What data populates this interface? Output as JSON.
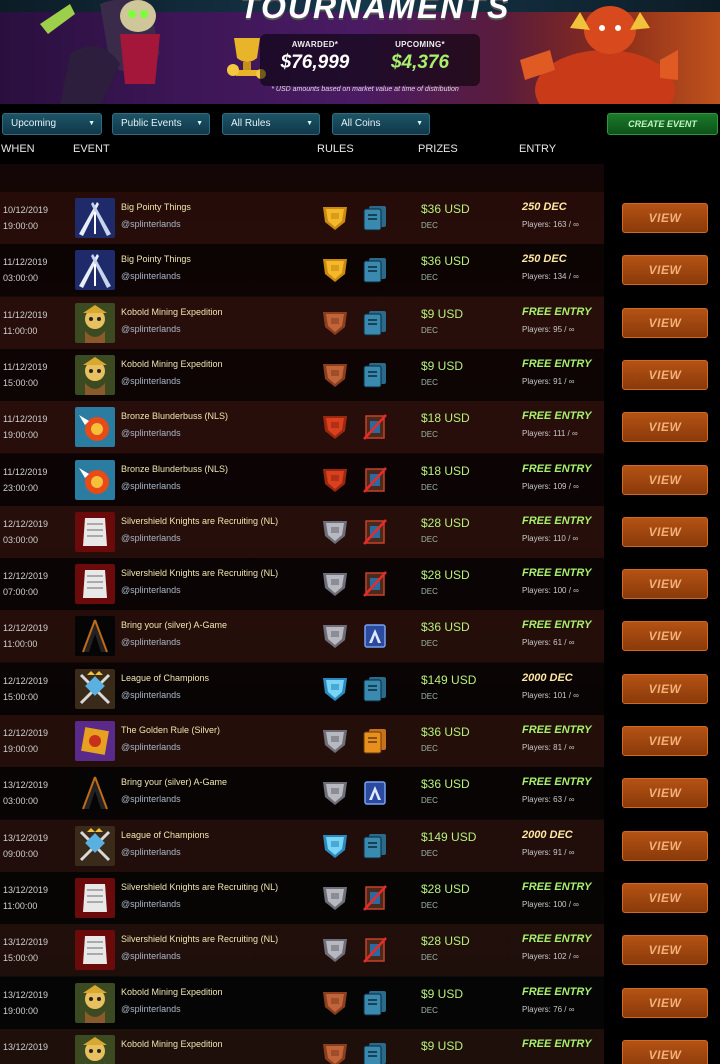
{
  "banner": {
    "title": "TOURNAMENTS",
    "awarded_label": "AWARDED*",
    "awarded_value": "$76,999",
    "upcoming_label": "UPCOMING*",
    "upcoming_value": "$4,376",
    "note": "* USD amounts based on market value at time of distribution"
  },
  "filters": {
    "status": "Upcoming",
    "visibility": "Public Events",
    "rules": "All Rules",
    "coins": "All Coins",
    "create_label": "CREATE EVENT"
  },
  "columns": {
    "when": "WHEN",
    "event": "EVENT",
    "rules": "RULES",
    "prizes": "PRIZES",
    "entry": "ENTRY"
  },
  "view_label": "VIEW",
  "events": [
    {
      "date": "10/12/2019",
      "time": "19:00:00",
      "name": "Big Pointy Things",
      "org": "@splinterlands",
      "thumb": "pointy",
      "rule1": "gold",
      "rule2": "blue",
      "prize": "$36 USD",
      "prize_sub": "DEC",
      "entry": "250 DEC",
      "free": false,
      "players": "Players: 163 / ∞"
    },
    {
      "date": "11/12/2019",
      "time": "03:00:00",
      "name": "Big Pointy Things",
      "org": "@splinterlands",
      "thumb": "pointy",
      "rule1": "gold",
      "rule2": "blue",
      "prize": "$36 USD",
      "prize_sub": "DEC",
      "entry": "250 DEC",
      "free": false,
      "players": "Players: 134 / ∞"
    },
    {
      "date": "11/12/2019",
      "time": "11:00:00",
      "name": "Kobold Mining Expedition",
      "org": "@splinterlands",
      "thumb": "kobold",
      "rule1": "bronze",
      "rule2": "blue",
      "prize": "$9 USD",
      "prize_sub": "DEC",
      "entry": "FREE ENTRY",
      "free": true,
      "players": "Players: 95 / ∞"
    },
    {
      "date": "11/12/2019",
      "time": "15:00:00",
      "name": "Kobold Mining Expedition",
      "org": "@splinterlands",
      "thumb": "kobold",
      "rule1": "bronze",
      "rule2": "blue",
      "prize": "$9 USD",
      "prize_sub": "DEC",
      "entry": "FREE ENTRY",
      "free": true,
      "players": "Players: 91 / ∞"
    },
    {
      "date": "11/12/2019",
      "time": "19:00:00",
      "name": "Bronze Blunderbuss (NLS)",
      "org": "@splinterlands",
      "thumb": "blunder",
      "rule1": "red",
      "rule2": "nolegend",
      "prize": "$18 USD",
      "prize_sub": "DEC",
      "entry": "FREE ENTRY",
      "free": true,
      "players": "Players: 111 / ∞"
    },
    {
      "date": "11/12/2019",
      "time": "23:00:00",
      "name": "Bronze Blunderbuss (NLS)",
      "org": "@splinterlands",
      "thumb": "blunder",
      "rule1": "red",
      "rule2": "nolegend",
      "prize": "$18 USD",
      "prize_sub": "DEC",
      "entry": "FREE ENTRY",
      "free": true,
      "players": "Players: 109 / ∞"
    },
    {
      "date": "12/12/2019",
      "time": "03:00:00",
      "name": "Silvershield Knights are Recruiting (NL)",
      "org": "@splinterlands",
      "thumb": "silver",
      "rule1": "silver",
      "rule2": "nolegend",
      "prize": "$28 USD",
      "prize_sub": "DEC",
      "entry": "FREE ENTRY",
      "free": true,
      "players": "Players: 110 / ∞"
    },
    {
      "date": "12/12/2019",
      "time": "07:00:00",
      "name": "Silvershield Knights are Recruiting (NL)",
      "org": "@splinterlands",
      "thumb": "silver",
      "rule1": "silver",
      "rule2": "nolegend",
      "prize": "$28 USD",
      "prize_sub": "DEC",
      "entry": "FREE ENTRY",
      "free": true,
      "players": "Players: 100 / ∞"
    },
    {
      "date": "12/12/2019",
      "time": "11:00:00",
      "name": "Bring your (silver) A-Game",
      "org": "@splinterlands",
      "thumb": "agame",
      "rule1": "silver",
      "rule2": "agame",
      "prize": "$36 USD",
      "prize_sub": "DEC",
      "entry": "FREE ENTRY",
      "free": true,
      "players": "Players: 61 / ∞"
    },
    {
      "date": "12/12/2019",
      "time": "15:00:00",
      "name": "League of Champions",
      "org": "@splinterlands",
      "thumb": "league",
      "rule1": "diamond",
      "rule2": "blue",
      "prize": "$149 USD",
      "prize_sub": "DEC",
      "entry": "2000 DEC",
      "free": false,
      "players": "Players: 101 / ∞"
    },
    {
      "date": "12/12/2019",
      "time": "19:00:00",
      "name": "The Golden Rule (Silver)",
      "org": "@splinterlands",
      "thumb": "golden",
      "rule1": "silver",
      "rule2": "orange",
      "prize": "$36 USD",
      "prize_sub": "DEC",
      "entry": "FREE ENTRY",
      "free": true,
      "players": "Players: 81 / ∞"
    },
    {
      "date": "13/12/2019",
      "time": "03:00:00",
      "name": "Bring your (silver) A-Game",
      "org": "@splinterlands",
      "thumb": "agame",
      "rule1": "silver",
      "rule2": "agame",
      "prize": "$36 USD",
      "prize_sub": "DEC",
      "entry": "FREE ENTRY",
      "free": true,
      "players": "Players: 63 / ∞"
    },
    {
      "date": "13/12/2019",
      "time": "09:00:00",
      "name": "League of Champions",
      "org": "@splinterlands",
      "thumb": "league",
      "rule1": "diamond",
      "rule2": "blue",
      "prize": "$149 USD",
      "prize_sub": "DEC",
      "entry": "2000 DEC",
      "free": false,
      "players": "Players: 91 / ∞"
    },
    {
      "date": "13/12/2019",
      "time": "11:00:00",
      "name": "Silvershield Knights are Recruiting (NL)",
      "org": "@splinterlands",
      "thumb": "silver",
      "rule1": "silver",
      "rule2": "nolegend",
      "prize": "$28 USD",
      "prize_sub": "DEC",
      "entry": "FREE ENTRY",
      "free": true,
      "players": "Players: 100 / ∞"
    },
    {
      "date": "13/12/2019",
      "time": "15:00:00",
      "name": "Silvershield Knights are Recruiting (NL)",
      "org": "@splinterlands",
      "thumb": "silver",
      "rule1": "silver",
      "rule2": "nolegend",
      "prize": "$28 USD",
      "prize_sub": "DEC",
      "entry": "FREE ENTRY",
      "free": true,
      "players": "Players: 102 / ∞"
    },
    {
      "date": "13/12/2019",
      "time": "19:00:00",
      "name": "Kobold Mining Expedition",
      "org": "@splinterlands",
      "thumb": "kobold",
      "rule1": "bronze",
      "rule2": "blue",
      "prize": "$9 USD",
      "prize_sub": "DEC",
      "entry": "FREE ENTRY",
      "free": true,
      "players": "Players: 76 / ∞"
    },
    {
      "date": "13/12/2019",
      "time": "",
      "name": "Kobold Mining Expedition",
      "org": "",
      "thumb": "kobold",
      "rule1": "bronze",
      "rule2": "blue",
      "prize": "$9 USD",
      "prize_sub": "",
      "entry": "FREE ENTRY",
      "free": true,
      "players": ""
    }
  ]
}
